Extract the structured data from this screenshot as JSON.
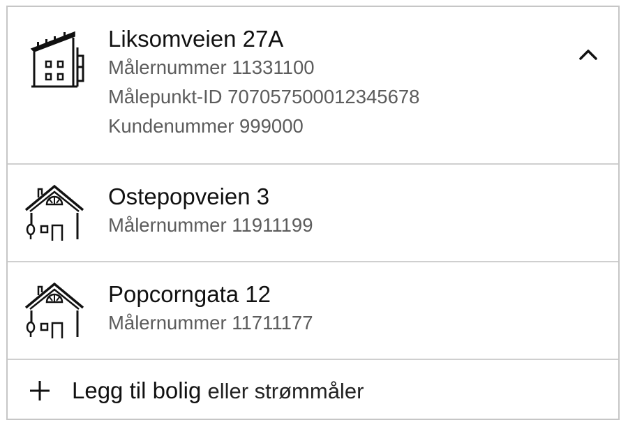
{
  "locations": [
    {
      "icon": "apartment-building-icon",
      "title": "Liksomveien 27A",
      "expanded": true,
      "details": [
        "Målernummer 11331100",
        "Målepunkt-ID 707057500012345678",
        "Kundenummer 999000"
      ]
    },
    {
      "icon": "house-icon",
      "title": "Ostepopveien 3",
      "details": [
        "Målernummer 11911199"
      ]
    },
    {
      "icon": "house-icon",
      "title": "Popcorngata 12",
      "details": [
        "Målernummer 11711177"
      ]
    }
  ],
  "add": {
    "icon": "plus-icon",
    "label_strong": "Legg til bolig",
    "label_rest": "eller strømmåler"
  },
  "toggle_icon": "chevron-up-icon",
  "colors": {
    "border": "#c6c6c6",
    "text": "#111111",
    "secondary_text": "#5c5c5c"
  }
}
